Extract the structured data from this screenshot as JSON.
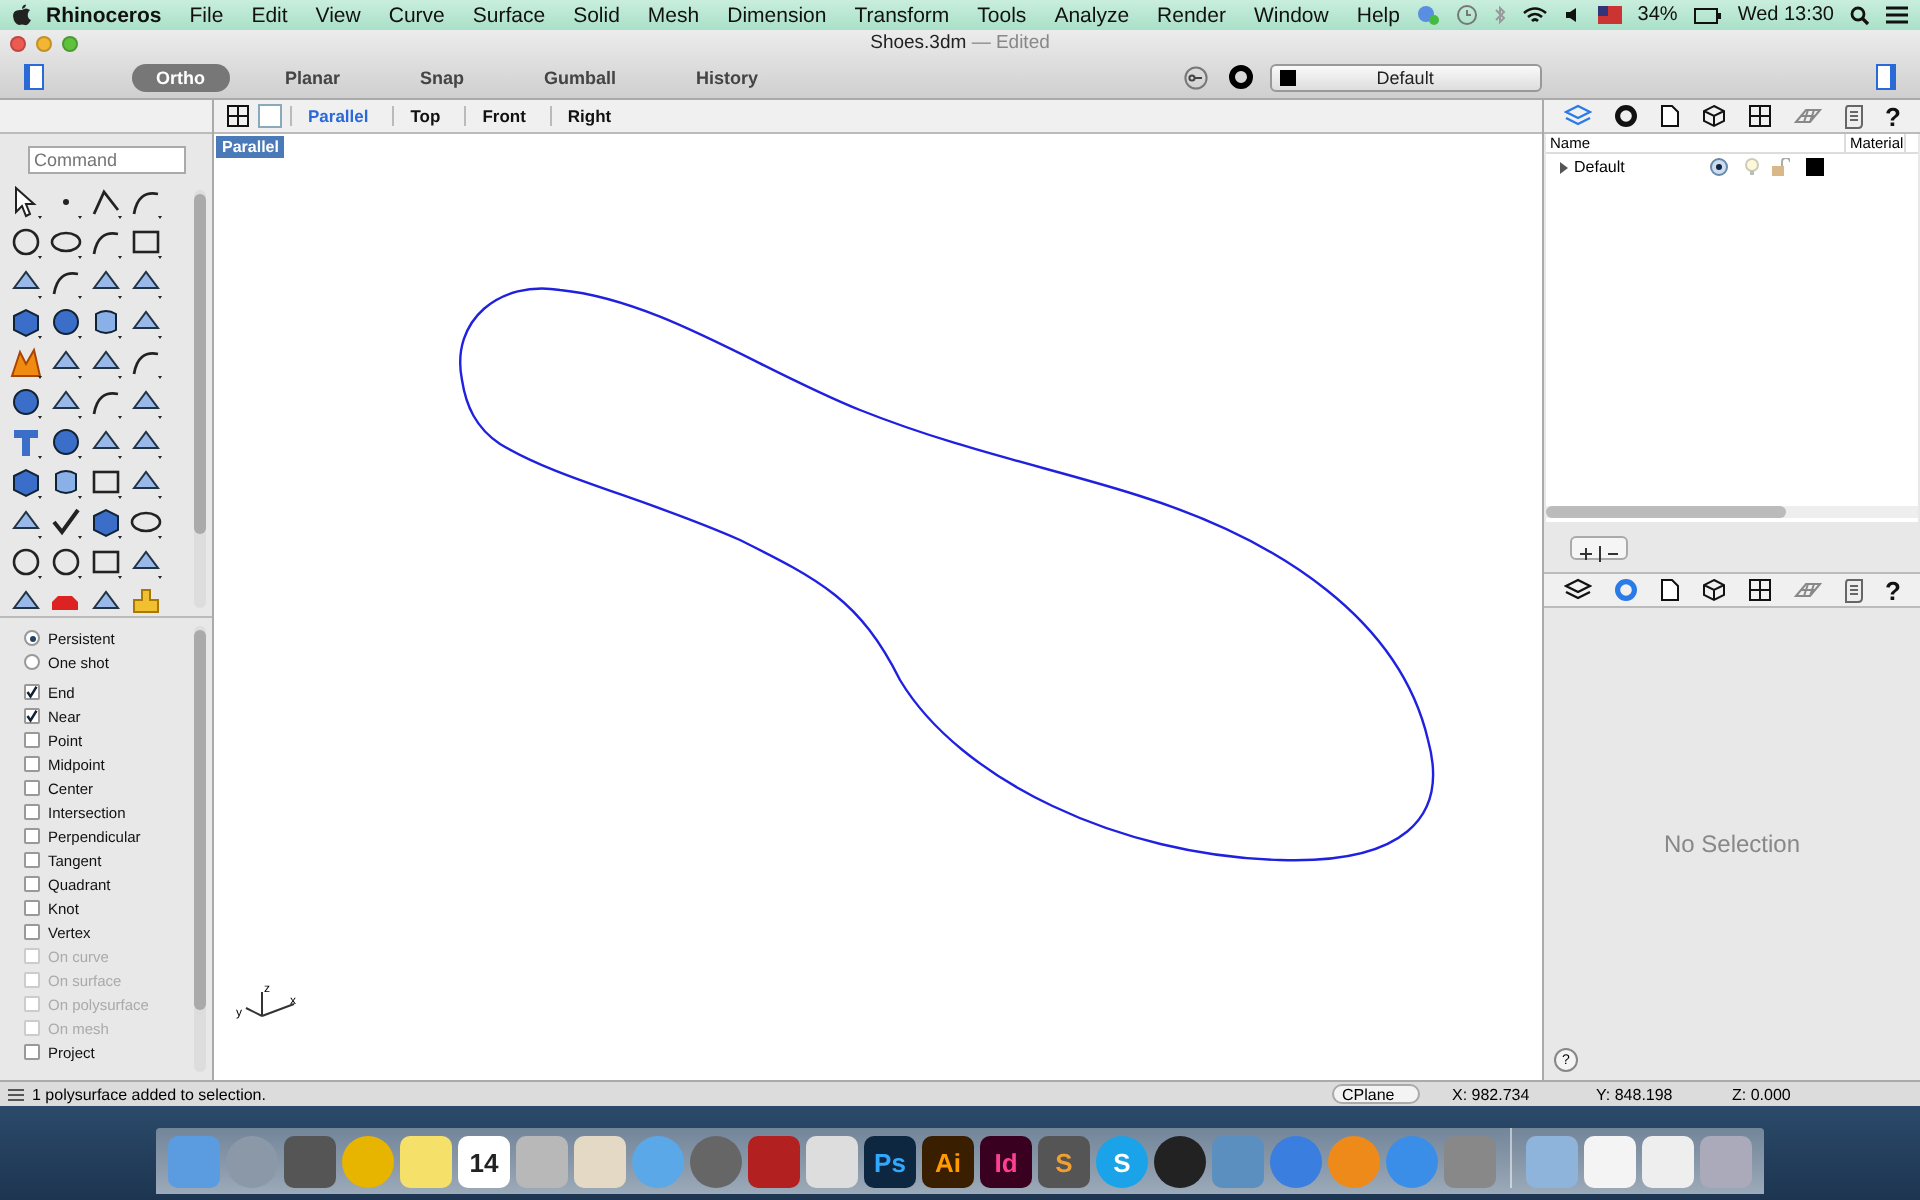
{
  "menubar": {
    "app": "Rhinoceros",
    "items": [
      "File",
      "Edit",
      "View",
      "Curve",
      "Surface",
      "Solid",
      "Mesh",
      "Dimension",
      "Transform",
      "Tools",
      "Analyze",
      "Render",
      "Window",
      "Help"
    ],
    "battery": "34%",
    "clock": "Wed 13:30"
  },
  "window": {
    "title": "Shoes.3dm",
    "subtitle": "— Edited"
  },
  "toolbar": {
    "toggles": [
      {
        "label": "Ortho",
        "selected": true
      },
      {
        "label": "Planar",
        "selected": false
      },
      {
        "label": "Snap",
        "selected": false
      },
      {
        "label": "Gumball",
        "selected": false
      },
      {
        "label": "History",
        "selected": false
      }
    ],
    "layer": "Default"
  },
  "viewport": {
    "tabs": [
      {
        "label": "Parallel",
        "selected": true
      },
      {
        "label": "Top",
        "selected": false
      },
      {
        "label": "Front",
        "selected": false
      },
      {
        "label": "Right",
        "selected": false
      }
    ],
    "label": "Parallel",
    "axes": {
      "x": "x",
      "y": "y",
      "z": "z"
    }
  },
  "command": {
    "placeholder": "Command"
  },
  "snaps": [
    {
      "kind": "radio",
      "label": "Persistent",
      "checked": true,
      "disabled": false
    },
    {
      "kind": "radio",
      "label": "One shot",
      "checked": false,
      "disabled": false
    },
    {
      "kind": "check",
      "label": "End",
      "checked": true,
      "disabled": false
    },
    {
      "kind": "check",
      "label": "Near",
      "checked": true,
      "disabled": false
    },
    {
      "kind": "check",
      "label": "Point",
      "checked": false,
      "disabled": false
    },
    {
      "kind": "check",
      "label": "Midpoint",
      "checked": false,
      "disabled": false
    },
    {
      "kind": "check",
      "label": "Center",
      "checked": false,
      "disabled": false
    },
    {
      "kind": "check",
      "label": "Intersection",
      "checked": false,
      "disabled": false
    },
    {
      "kind": "check",
      "label": "Perpendicular",
      "checked": false,
      "disabled": false
    },
    {
      "kind": "check",
      "label": "Tangent",
      "checked": false,
      "disabled": false
    },
    {
      "kind": "check",
      "label": "Quadrant",
      "checked": false,
      "disabled": false
    },
    {
      "kind": "check",
      "label": "Knot",
      "checked": false,
      "disabled": false
    },
    {
      "kind": "check",
      "label": "Vertex",
      "checked": false,
      "disabled": false
    },
    {
      "kind": "check",
      "label": "On curve",
      "checked": false,
      "disabled": true
    },
    {
      "kind": "check",
      "label": "On surface",
      "checked": false,
      "disabled": true
    },
    {
      "kind": "check",
      "label": "On polysurface",
      "checked": false,
      "disabled": true
    },
    {
      "kind": "check",
      "label": "On mesh",
      "checked": false,
      "disabled": true
    },
    {
      "kind": "check",
      "label": "Project",
      "checked": false,
      "disabled": false
    }
  ],
  "layers_panel": {
    "tabs": [
      {
        "kind": "layers",
        "selected": true
      },
      {
        "kind": "material",
        "selected": false
      },
      {
        "kind": "document",
        "selected": false
      },
      {
        "kind": "cube",
        "selected": false
      },
      {
        "kind": "viewports",
        "selected": false
      },
      {
        "kind": "render",
        "selected": false
      },
      {
        "kind": "notes",
        "selected": false
      },
      {
        "kind": "help",
        "label": "?",
        "selected": false
      }
    ],
    "columns": [
      "Name",
      "Material"
    ],
    "rows": [
      {
        "name": "Default",
        "expanded": false,
        "current": true,
        "color": "#000000"
      }
    ]
  },
  "properties_panel": {
    "tabs": [
      {
        "kind": "layers",
        "selected": false
      },
      {
        "kind": "material",
        "selected": true
      },
      {
        "kind": "document",
        "selected": false
      },
      {
        "kind": "cube",
        "selected": false
      },
      {
        "kind": "viewports",
        "selected": false
      },
      {
        "kind": "render",
        "selected": false
      },
      {
        "kind": "notes",
        "selected": false
      },
      {
        "kind": "help",
        "label": "?",
        "selected": false
      }
    ],
    "message": "No Selection",
    "help": "?"
  },
  "status_bar": {
    "message": "1 polysurface added to selection.",
    "cplane": "CPlane",
    "x": "X: 982.734",
    "y": "Y: 848.198",
    "z": "Z: 0.000"
  },
  "dock": [
    {
      "kind": "finder"
    },
    {
      "kind": "rocket"
    },
    {
      "kind": "photobooth"
    },
    {
      "kind": "chrome"
    },
    {
      "kind": "stickies"
    },
    {
      "kind": "calendar",
      "label": "14"
    },
    {
      "kind": "calculator"
    },
    {
      "kind": "preview"
    },
    {
      "kind": "messages"
    },
    {
      "kind": "facetime"
    },
    {
      "kind": "photo"
    },
    {
      "kind": "inkscape"
    },
    {
      "kind": "ps",
      "label": "Ps"
    },
    {
      "kind": "ai",
      "label": "Ai"
    },
    {
      "kind": "id",
      "label": "Id"
    },
    {
      "kind": "sublime",
      "label": "S"
    },
    {
      "kind": "skype",
      "label": "S"
    },
    {
      "kind": "meter"
    },
    {
      "kind": "iphoto"
    },
    {
      "kind": "itunes"
    },
    {
      "kind": "ibooks"
    },
    {
      "kind": "appstore"
    },
    {
      "kind": "prefs"
    },
    {
      "kind": "separator"
    },
    {
      "kind": "folder"
    },
    {
      "kind": "doc"
    },
    {
      "kind": "mail"
    },
    {
      "kind": "trash"
    }
  ]
}
